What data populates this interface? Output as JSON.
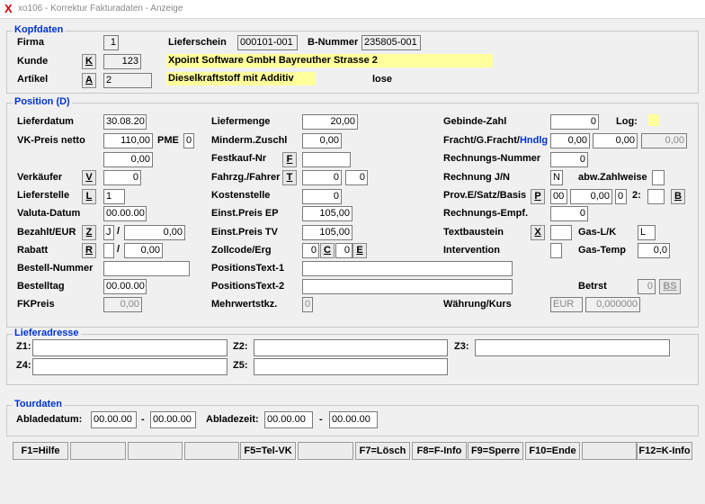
{
  "window": {
    "title": "xo106 - Korrektur Fakturadaten - Anzeige"
  },
  "kopf": {
    "title": "Kopfdaten",
    "firma_label": "Firma",
    "firma": "1",
    "kunde_label": "Kunde",
    "kunde_btn": "K",
    "kunde": "123",
    "artikel_label": "Artikel",
    "artikel_btn": "A",
    "artikel": "2",
    "lieferschein_label": "Lieferschein",
    "lieferschein": "000101-001",
    "bnummer_label": "B-Nummer",
    "bnummer": "235805-001",
    "kunde_name": "Xpoint Software GmbH Bayreuther Strasse 2",
    "artikel_name": "Dieselkraftstoff mit Additiv",
    "lose": "lose"
  },
  "pos": {
    "title": "Position (D)",
    "lieferdatum_label": "Lieferdatum",
    "lieferdatum": "30.08.20",
    "vkpreis_label": "VK-Preis netto",
    "vkpreis": "110,00",
    "pme_label": "PME",
    "pme": "0",
    "vkpreis2": "0,00",
    "verkaeufer_label": "Verkäufer",
    "verkaeufer_btn": "V",
    "verkaeufer": "0",
    "lieferstelle_label": "Lieferstelle",
    "lieferstelle_btn": "L",
    "lieferstelle": "1",
    "valuta_label": "Valuta-Datum",
    "valuta": "00.00.00",
    "bezahlt_label": "Bezahlt/EUR",
    "bezahlt_btn": "Z",
    "bezahlt_a": "J",
    "slash": "/",
    "bezahlt_b": "0,00",
    "rabatt_label": "Rabatt",
    "rabatt_btn": "R",
    "rabatt": "0,00",
    "bestellnr_label": "Bestell-Nummer",
    "bestellnr": "",
    "bestelltag_label": "Bestelltag",
    "bestelltag": "00.00.00",
    "fkpreis_label": "FKPreis",
    "fkpreis": "0,00",
    "liefermenge_label": "Liefermenge",
    "liefermenge": "20,00",
    "minderm_label": "Minderm.Zuschl",
    "minderm": "0,00",
    "festkauf_label": "Festkauf-Nr",
    "festkauf_btn": "F",
    "festkauf": "",
    "fahrzg_label": "Fahrzg./Fahrer",
    "fahrzg_btn": "T",
    "fahrzg_a": "0",
    "fahrzg_b": "0",
    "kostenstelle_label": "Kostenstelle",
    "kostenstelle": "0",
    "einst_ep_label": "Einst.Preis EP",
    "einst_ep": "105,00",
    "einst_tv_label": "Einst.Preis TV",
    "einst_tv": "105,00",
    "zollcode_label": "Zollcode/Erg",
    "zoll_a": "0",
    "zoll_btn_c": "C",
    "zoll_b": "0",
    "zoll_btn_e": "E",
    "postext1_label": "PositionsText-1",
    "postext1": "",
    "postext2_label": "PositionsText-2",
    "postext2": "",
    "mwst_label": "Mehrwertstkz.",
    "mwst": "0",
    "gebinde_label": "Gebinde-Zahl",
    "gebinde": "0",
    "log_label": "Log:",
    "fracht_label_a": "Fracht/G.Fracht/",
    "fracht_label_b": "Hndlg",
    "fracht": "0,00",
    "gfracht": "0,00",
    "hndlg": "0,00",
    "rechnr_label": "Rechnungs-Nummer",
    "rechnr": "0",
    "rechjn_label": "Rechnung J/N",
    "rechjn": "N",
    "abwzahl_label": "abw.Zahlweise",
    "abwzahl": "",
    "prov_label": "Prov.E/Satz/Basis",
    "prov_btn": "P",
    "prov_e": "00",
    "prov_satz": "0,00",
    "prov_basis": "0",
    "two_label": "2:",
    "two_val": "",
    "b_btn": "B",
    "rechempf_label": "Rechnungs-Empf.",
    "rechempf": "0",
    "textbau_label": "Textbaustein",
    "textbau_btn": "X",
    "textbau": "",
    "gaslk_label": "Gas-L/K",
    "gaslk": "L",
    "intervention_label": "Intervention",
    "intervention": "",
    "gastemp_label": "Gas-Temp",
    "gastemp": "0,0",
    "betrst_label": "Betrst",
    "betrst": "0",
    "bs_btn": "BS",
    "waehrung_label": "Währung/Kurs",
    "waehrung": "EUR",
    "kurs": "0,000000"
  },
  "liefer": {
    "title": "Lieferadresse",
    "z1_label": "Z1:",
    "z1": "",
    "z2_label": "Z2:",
    "z2": "",
    "z3_label": "Z3:",
    "z3": "",
    "z4_label": "Z4:",
    "z4": "",
    "z5_label": "Z5:",
    "z5": ""
  },
  "tour": {
    "title": "Tourdaten",
    "abladedatum_label": "Abladedatum:",
    "abladedatum_a": "00.00.00",
    "dash": "-",
    "abladedatum_b": "00.00.00",
    "abladezeit_label": "Abladezeit:",
    "abladezeit_a": "00.00.00",
    "abladezeit_b": "00.00.00"
  },
  "fkeys": [
    "F1=Hilfe",
    "",
    "",
    "",
    "F5=Tel-VK",
    "",
    "F7=Lösch",
    "F8=F-Info",
    "F9=Sperre",
    "F10=Ende",
    "",
    "F12=K-Info"
  ],
  "colors": {
    "accent": "#0033cc",
    "highlight": "#ffff9c",
    "close_x": "#d40000"
  }
}
